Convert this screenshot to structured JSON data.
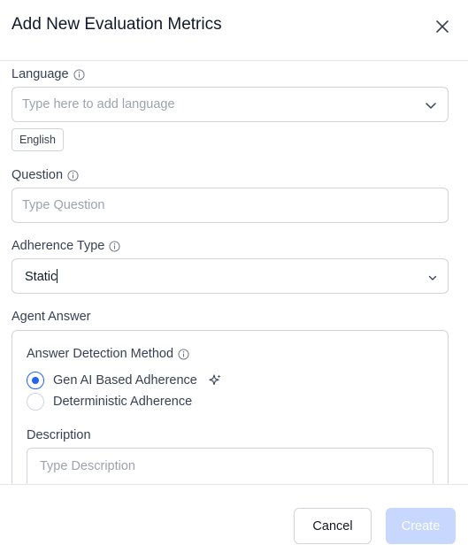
{
  "header": {
    "title": "Add New Evaluation Metrics"
  },
  "language": {
    "label": "Language",
    "placeholder": "Type here to add language",
    "selected_tags": [
      "English"
    ]
  },
  "question": {
    "label": "Question",
    "placeholder": "Type Question"
  },
  "adherence": {
    "label": "Adherence Type",
    "value": "Static"
  },
  "agent_answer": {
    "title": "Agent Answer",
    "detection_label": "Answer Detection Method",
    "options": [
      {
        "label": "Gen AI Based Adherence",
        "checked": true
      },
      {
        "label": "Deterministic Adherence",
        "checked": false
      }
    ],
    "description_label": "Description",
    "description_placeholder": "Type Description"
  },
  "footer": {
    "cancel_label": "Cancel",
    "create_label": "Create"
  },
  "colors": {
    "accent": "#2563eb",
    "create_disabled": "#c7d7fe",
    "border": "#d1d5db"
  }
}
